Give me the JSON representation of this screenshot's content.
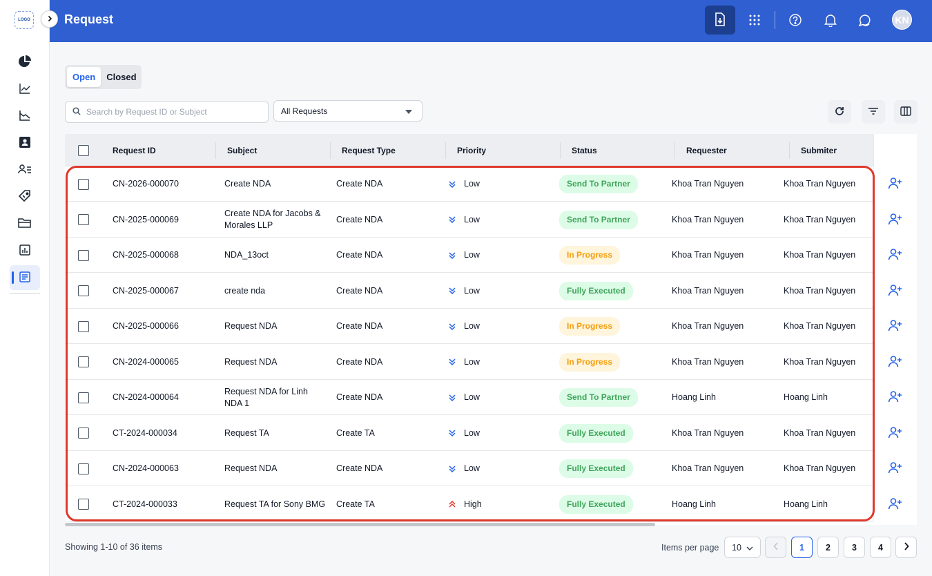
{
  "sidebar": {
    "logo_text": "LOGO",
    "items": [
      {
        "icon": "pie-chart-icon"
      },
      {
        "icon": "trend-chart-icon"
      },
      {
        "icon": "area-chart-icon"
      },
      {
        "icon": "contacts-book-icon"
      },
      {
        "icon": "user-list-icon"
      },
      {
        "icon": "tag-icon"
      },
      {
        "icon": "folder-icon"
      },
      {
        "icon": "bar-report-icon"
      },
      {
        "icon": "request-doc-icon",
        "active": true
      }
    ]
  },
  "header": {
    "title": "Request",
    "avatar_initials": "KN",
    "accent_color": "#2f5fd0"
  },
  "tabs": [
    {
      "label": "Open",
      "active": true
    },
    {
      "label": "Closed",
      "active": false
    }
  ],
  "search": {
    "placeholder": "Search by Request ID or Subject",
    "value": ""
  },
  "filter": {
    "selected": "All Requests"
  },
  "table": {
    "columns": [
      "Request ID",
      "Subject",
      "Request Type",
      "Priority",
      "Status",
      "Requester",
      "Submiter"
    ],
    "rows": [
      {
        "id": "CN-2026-000070",
        "subject": "Create NDA",
        "type": "Create NDA",
        "priority": "Low",
        "status": "Send To Partner",
        "requester": "Khoa Tran Nguyen",
        "submiter": "Khoa Tran Nguyen"
      },
      {
        "id": "CN-2025-000069",
        "subject": "Create NDA for Jacobs & Morales LLP",
        "type": "Create NDA",
        "priority": "Low",
        "status": "Send To Partner",
        "requester": "Khoa Tran Nguyen",
        "submiter": "Khoa Tran Nguyen"
      },
      {
        "id": "CN-2025-000068",
        "subject": "NDA_13oct",
        "type": "Create NDA",
        "priority": "Low",
        "status": "In Progress",
        "requester": "Khoa Tran Nguyen",
        "submiter": "Khoa Tran Nguyen"
      },
      {
        "id": "CN-2025-000067",
        "subject": "create nda",
        "type": "Create NDA",
        "priority": "Low",
        "status": "Fully Executed",
        "requester": "Khoa Tran Nguyen",
        "submiter": "Khoa Tran Nguyen"
      },
      {
        "id": "CN-2025-000066",
        "subject": "Request NDA",
        "type": "Create NDA",
        "priority": "Low",
        "status": "In Progress",
        "requester": "Khoa Tran Nguyen",
        "submiter": "Khoa Tran Nguyen"
      },
      {
        "id": "CN-2024-000065",
        "subject": "Request NDA",
        "type": "Create NDA",
        "priority": "Low",
        "status": "In Progress",
        "requester": "Khoa Tran Nguyen",
        "submiter": "Khoa Tran Nguyen"
      },
      {
        "id": "CN-2024-000064",
        "subject": "Request NDA for Linh NDA 1",
        "type": "Create NDA",
        "priority": "Low",
        "status": "Send To Partner",
        "requester": "Hoang Linh",
        "submiter": "Hoang Linh"
      },
      {
        "id": "CT-2024-000034",
        "subject": "Request TA",
        "type": "Create TA",
        "priority": "Low",
        "status": "Fully Executed",
        "requester": "Khoa Tran Nguyen",
        "submiter": "Khoa Tran Nguyen"
      },
      {
        "id": "CN-2024-000063",
        "subject": "Request NDA",
        "type": "Create NDA",
        "priority": "Low",
        "status": "Fully Executed",
        "requester": "Khoa Tran Nguyen",
        "submiter": "Khoa Tran Nguyen"
      },
      {
        "id": "CT-2024-000033",
        "subject": "Request TA for Sony BMG",
        "type": "Create TA",
        "priority": "High",
        "status": "Fully Executed",
        "requester": "Hoang Linh",
        "submiter": "Hoang Linh"
      }
    ]
  },
  "footer": {
    "showing": "Showing 1-10 of 36 items",
    "items_per_page_label": "Items per page",
    "items_per_page": "10",
    "pages": [
      "1",
      "2",
      "3",
      "4"
    ],
    "current_page": "1"
  },
  "colors": {
    "status_green_bg": "#dcfce7",
    "status_green_text": "#3fa55b",
    "status_orange_bg": "#fff4dc",
    "status_orange_text": "#f59e0b",
    "priority_low": "#2563eb",
    "priority_high": "#e0382b",
    "highlight": "#e0382b"
  }
}
